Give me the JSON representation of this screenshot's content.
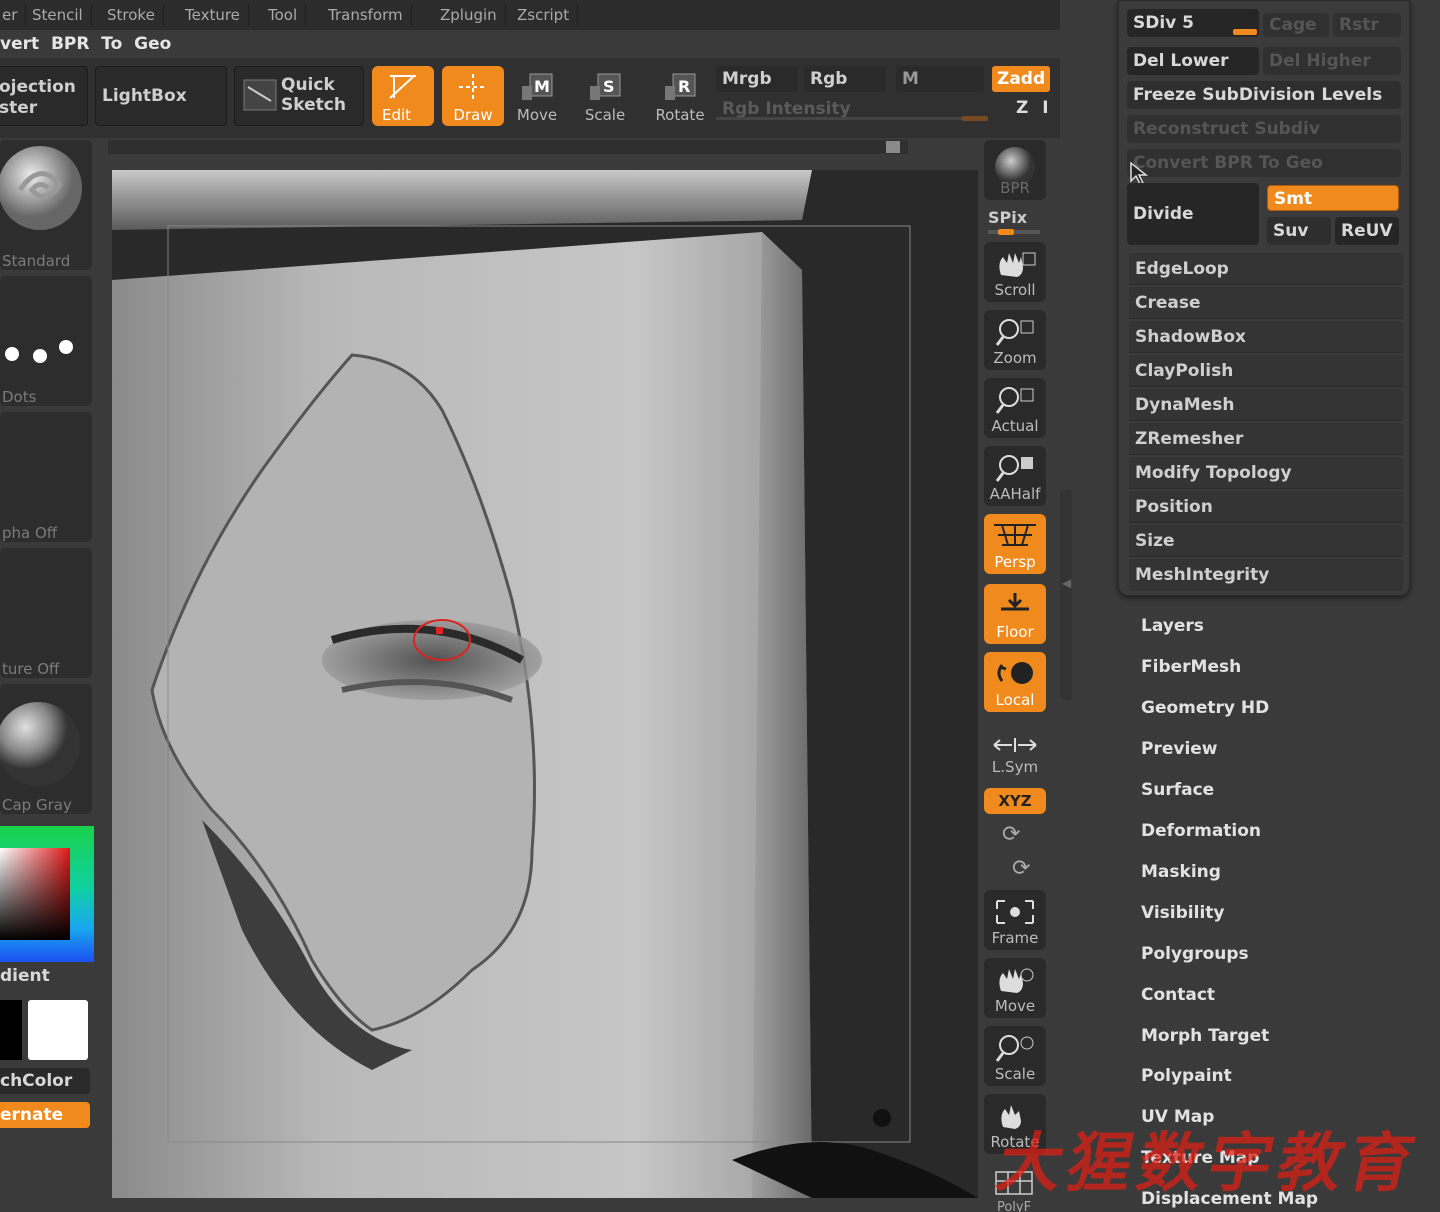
{
  "menu": [
    "er",
    "Stencil",
    "Stroke",
    "Texture",
    "Tool",
    "Transform",
    "Zplugin",
    "Zscript"
  ],
  "top_left_title": "vert  BPR  To  Geo",
  "projection_master": "ojection\nster",
  "lightbox": "LightBox",
  "quick_sketch": "Quick\nSketch",
  "tools": {
    "edit": "Edit",
    "draw": "Draw",
    "move": "Move",
    "scale": "Scale",
    "rotate": "Rotate",
    "move_key": "M",
    "scale_key": "S",
    "rotate_key": "R"
  },
  "color_modes": {
    "mrgb": "Mrgb",
    "rgb": "Rgb",
    "m": "M",
    "zadd": "Zadd",
    "rgb_intensity": "Rgb  Intensity",
    "z": "Z I"
  },
  "left_shelf": {
    "brush": "Standard",
    "stroke": "Dots",
    "alpha": "pha  Off",
    "texture": "ture  Off",
    "material": "Cap  Gray",
    "gradient": "dient",
    "switch_color": "chColor",
    "alternate": "ernate"
  },
  "right_shelf": [
    "BPR",
    "SPix",
    "Scroll",
    "Zoom",
    "Actual",
    "AAHalf",
    "Persp",
    "Floor",
    "Local",
    "L.Sym",
    "XYZ",
    "Frame",
    "Move",
    "Scale",
    "Rotate",
    "PolyF"
  ],
  "geometry_panel": {
    "sdiv": "SDiv 5",
    "cage": "Cage",
    "rstr": "Rstr",
    "del_lower": "Del  Lower",
    "del_higher": "Del  Higher",
    "freeze": "Freeze  SubDivision  Levels",
    "reconstruct": "Reconstruct  Subdiv",
    "convert": "Convert  BPR  To  Geo",
    "divide": "Divide",
    "smt": "Smt",
    "suv": "Suv",
    "reuv": "ReUV",
    "subpanels": [
      "EdgeLoop",
      "Crease",
      "ShadowBox",
      "ClayPolish",
      "DynaMesh",
      "ZRemesher",
      "Modify  Topology",
      "Position",
      "Size",
      "MeshIntegrity"
    ]
  },
  "tool_subpalettes": [
    "Layers",
    "FiberMesh",
    "Geometry  HD",
    "Preview",
    "Surface",
    "Deformation",
    "Masking",
    "Visibility",
    "Polygroups",
    "Contact",
    "Morph  Target",
    "Polypaint",
    "UV  Map",
    "Texture  Map",
    "Displacement  Map"
  ],
  "watermark": "大猩数字教育",
  "colors": {
    "accent": "#f08a1c",
    "bg": "#3a3a3a"
  }
}
